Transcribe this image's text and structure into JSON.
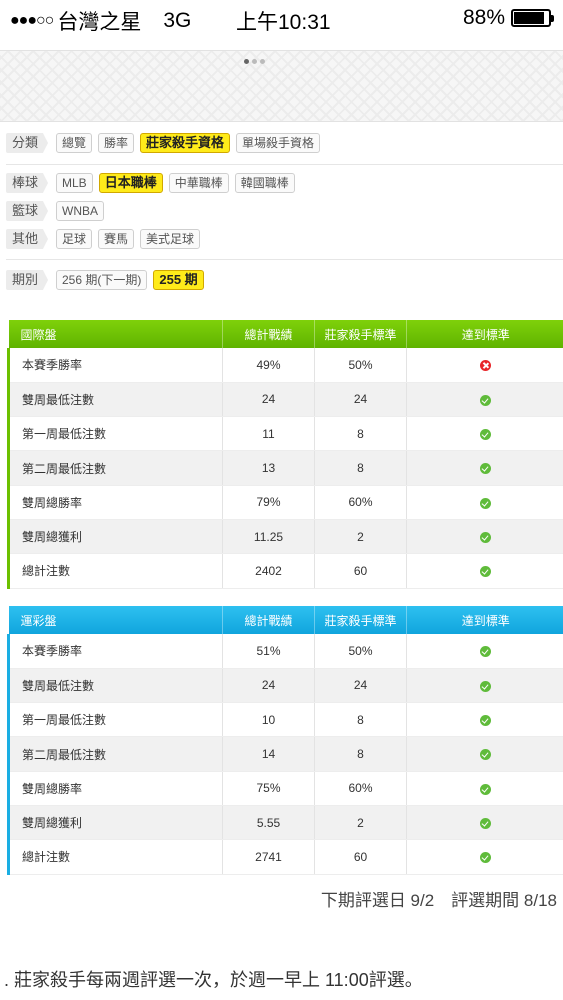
{
  "status_bar": {
    "signal": "●●●○○",
    "carrier": "台灣之星",
    "network": "3G",
    "time": "上午10:31",
    "battery_text": "88%",
    "battery_level": 0.88
  },
  "filters": {
    "category": {
      "label": "分類",
      "options": [
        "總覽",
        "勝率",
        "莊家殺手資格",
        "單場殺手資格"
      ],
      "selected": "莊家殺手資格"
    },
    "baseball": {
      "label": "棒球",
      "options": [
        "MLB",
        "日本職棒",
        "中華職棒",
        "韓國職棒"
      ],
      "selected": "日本職棒"
    },
    "basketball": {
      "label": "籃球",
      "options": [
        "WNBA"
      ]
    },
    "other": {
      "label": "其他",
      "options": [
        "足球",
        "賽馬",
        "美式足球"
      ]
    },
    "period": {
      "label": "期別",
      "options": [
        "256 期(下一期)",
        "255 期"
      ],
      "selected": "255 期"
    }
  },
  "intl_table": {
    "headers": [
      "國際盤",
      "總計戰績",
      "莊家殺手標準",
      "達到標準"
    ],
    "rows": [
      {
        "label": "本賽季勝率",
        "total": "49%",
        "standard": "50%",
        "met": "fail-icon"
      },
      {
        "label": "雙周最低注數",
        "total": "24",
        "standard": "24",
        "met": "check-icon"
      },
      {
        "label": "第一周最低注數",
        "total": "11",
        "standard": "8",
        "met": "check-icon"
      },
      {
        "label": "第二周最低注數",
        "total": "13",
        "standard": "8",
        "met": "check-icon"
      },
      {
        "label": "雙周總勝率",
        "total": "79%",
        "standard": "60%",
        "met": "check-icon"
      },
      {
        "label": "雙周總獲利",
        "total": "11.25",
        "standard": "2",
        "met": "check-icon"
      },
      {
        "label": "總計注數",
        "total": "2402",
        "standard": "60",
        "met": "check-icon"
      }
    ]
  },
  "lottery_table": {
    "headers": [
      "運彩盤",
      "總計戰績",
      "莊家殺手標準",
      "達到標準"
    ],
    "rows": [
      {
        "label": "本賽季勝率",
        "total": "51%",
        "standard": "50%",
        "met": "check-icon"
      },
      {
        "label": "雙周最低注數",
        "total": "24",
        "standard": "24",
        "met": "check-icon"
      },
      {
        "label": "第一周最低注數",
        "total": "10",
        "standard": "8",
        "met": "check-icon"
      },
      {
        "label": "第二周最低注數",
        "total": "14",
        "standard": "8",
        "met": "check-icon"
      },
      {
        "label": "雙周總勝率",
        "total": "75%",
        "standard": "60%",
        "met": "check-icon"
      },
      {
        "label": "雙周總獲利",
        "total": "5.55",
        "standard": "2",
        "met": "check-icon"
      },
      {
        "label": "總計注數",
        "total": "2741",
        "standard": "60",
        "met": "check-icon"
      }
    ]
  },
  "next_eval": "下期評選日 9/2　評選期間 8/18",
  "note": ".   莊家殺手每兩週評選一次，於週一早上 11:00評選。",
  "colors": {
    "intl_header": "#6cc000",
    "lottery_header": "#1aaee3",
    "selected_chip": "#ffeb1a"
  }
}
